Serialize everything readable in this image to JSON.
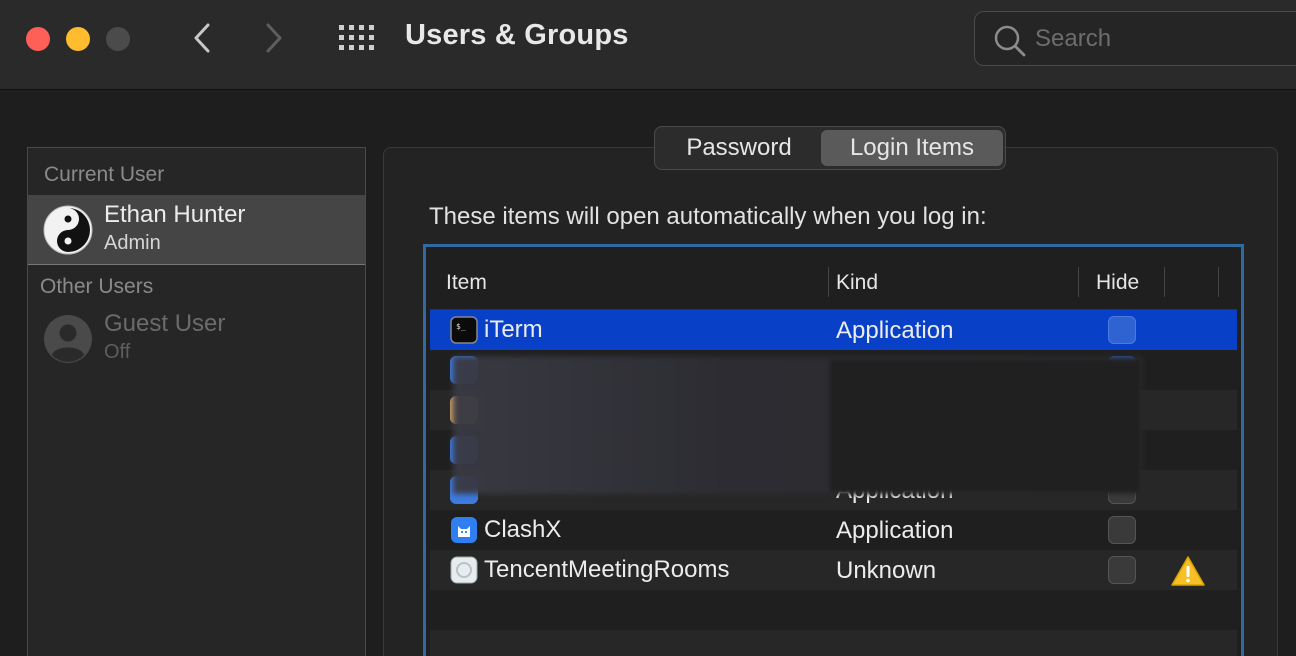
{
  "window": {
    "title": "Users & Groups"
  },
  "search": {
    "placeholder": "Search"
  },
  "sidebar": {
    "current_user_heading": "Current User",
    "other_users_heading": "Other Users",
    "current_user": {
      "name": "Ethan Hunter",
      "role": "Admin",
      "avatar_icon": "yin-yang-icon"
    },
    "other_users": [
      {
        "name": "Guest User",
        "status": "Off",
        "avatar_icon": "generic-user-icon"
      }
    ]
  },
  "tabs": {
    "items": [
      {
        "label": "Password",
        "selected": false
      },
      {
        "label": "Login Items",
        "selected": true
      }
    ]
  },
  "login_items": {
    "description": "These items will open automatically when you log in:",
    "columns": {
      "item": "Item",
      "kind": "Kind",
      "hide": "Hide"
    },
    "rows": [
      {
        "name": "iTerm",
        "kind": "Application",
        "hide": false,
        "selected": true,
        "icon": "terminal-icon",
        "warning": false
      },
      {
        "name": "",
        "kind": "",
        "hide": false,
        "selected": false,
        "icon": "obscured-icon",
        "warning": false,
        "obscured": true
      },
      {
        "name": "",
        "kind": "",
        "hide": false,
        "selected": false,
        "icon": "obscured-icon",
        "warning": false,
        "obscured": true
      },
      {
        "name": "",
        "kind": "",
        "hide": false,
        "selected": false,
        "icon": "obscured-icon",
        "warning": false,
        "obscured": true
      },
      {
        "name": "",
        "kind": "Application",
        "hide": false,
        "selected": false,
        "icon": "obscured-icon",
        "warning": false,
        "obscured": true
      },
      {
        "name": "ClashX",
        "kind": "Application",
        "hide": false,
        "selected": false,
        "icon": "clashx-cat-icon",
        "warning": false
      },
      {
        "name": "TencentMeetingRooms",
        "kind": "Unknown",
        "hide": false,
        "selected": false,
        "icon": "tencent-meeting-icon",
        "warning": true
      }
    ]
  },
  "colors": {
    "selection": "#0841c8",
    "table_focus_ring": "#2f6aa5",
    "close": "#fe5f57",
    "minimize": "#febc2e",
    "warning": "#f6c026"
  }
}
